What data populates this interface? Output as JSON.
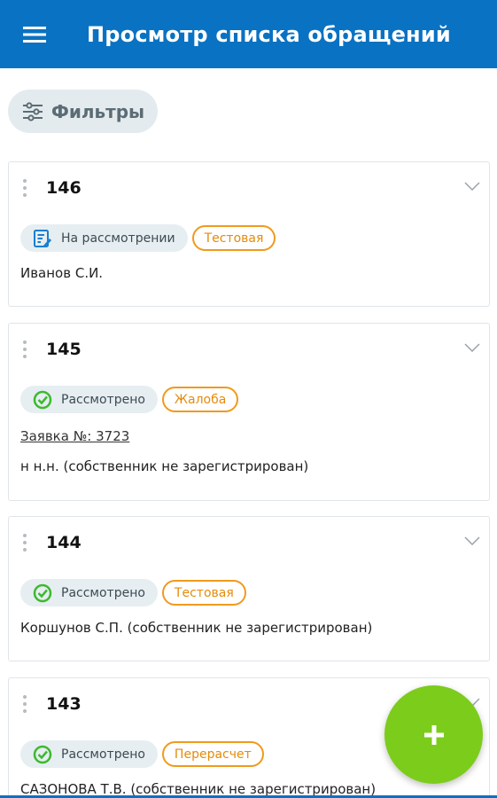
{
  "appbar": {
    "title": "Просмотр списка обращений",
    "menu_icon": "hamburger-icon"
  },
  "filters": {
    "label": "Фильтры",
    "icon": "sliders-icon"
  },
  "cards": [
    {
      "number": "146",
      "status": "На рассмотрении",
      "status_icon": "under-review-icon",
      "tag": "Тестовая",
      "lines": [
        "Иванов С.И."
      ]
    },
    {
      "number": "145",
      "status": "Рассмотрено",
      "status_icon": "check-circle-icon",
      "tag": "Жалоба",
      "link": "Заявка №: 3723",
      "lines": [
        "н н.н. (собственник не зарегистрирован)"
      ]
    },
    {
      "number": "144",
      "status": "Рассмотрено",
      "status_icon": "check-circle-icon",
      "tag": "Тестовая",
      "lines": [
        "Коршунов С.П. (собственник не зарегистрирован)"
      ]
    },
    {
      "number": "143",
      "status": "Рассмотрено",
      "status_icon": "check-circle-icon",
      "tag": "Перерасчет",
      "lines": [
        "САЗОНОВА Т.В. (собственник не зарегистрирован)"
      ]
    }
  ],
  "fab": {
    "label": "+"
  },
  "colors": {
    "primary": "#0a72c2",
    "accent_green": "#7ccc1b",
    "tag_orange": "#f09a1d",
    "check_green": "#3cba2c"
  }
}
